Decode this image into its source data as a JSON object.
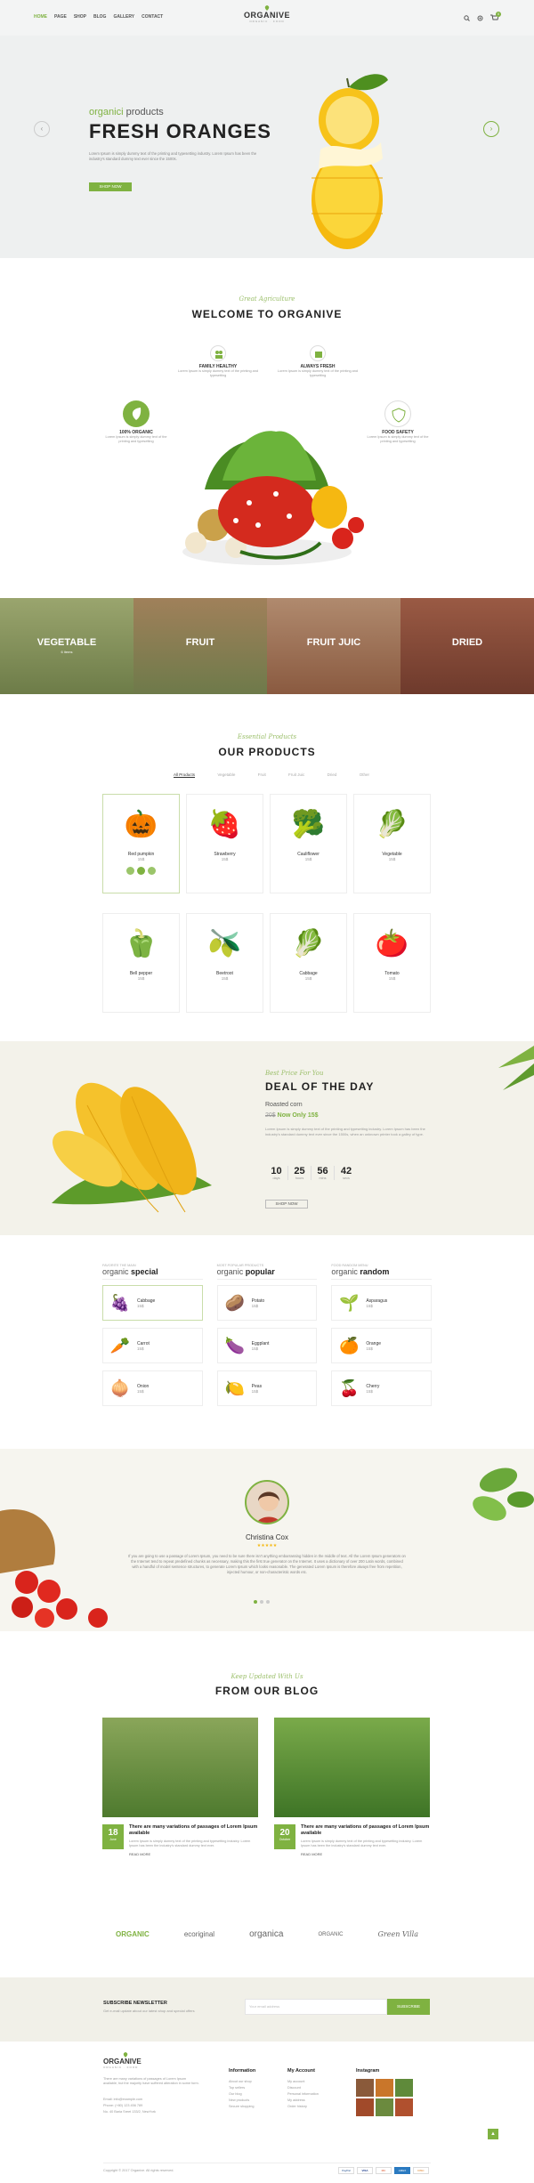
{
  "header": {
    "nav": [
      "HOME",
      "PAGE",
      "SHOP",
      "BLOG",
      "GALLERY",
      "CONTACT"
    ],
    "logo": "ORGANIVE",
    "logo_sub": "ORGANIC · FOOD",
    "cart_count": "0"
  },
  "hero": {
    "kicker_a": "organici",
    "kicker_b": "products",
    "title": "FRESH ORANGES",
    "desc": "Lorem Ipsum is simply dummy text of the printing and typesetting industry. Lorem Ipsum has been the industry's standard dummy text ever since the 1500s.",
    "button": "SHOP NOW"
  },
  "welcome": {
    "script": "Great Agriculture",
    "title": "WELCOME TO ORGANIVE",
    "features": [
      {
        "title": "FAMILY HEALTHY",
        "desc": "Lorem Ipsum is simply dummy text of the printing and typesetting",
        "icon": "family-icon"
      },
      {
        "title": "ALWAYS FRESH",
        "desc": "Lorem Ipsum is simply dummy text of the printing and typesetting",
        "icon": "basket-icon"
      },
      {
        "title": "100% ORGANIC",
        "desc": "Lorem Ipsum is simply dummy text of the printing and typesetting",
        "icon": "leaf-icon"
      },
      {
        "title": "FOOD SAFETY",
        "desc": "Lorem Ipsum is simply dummy text of the printing and typesetting",
        "icon": "shield-icon"
      }
    ]
  },
  "categories": [
    {
      "label": "VEGETABLE",
      "sub": "6 items",
      "color": "#7a8a55"
    },
    {
      "label": "FRUIT",
      "sub": "",
      "color": "#8e6a4a"
    },
    {
      "label": "FRUIT JUIC",
      "sub": "",
      "color": "#8a6a5a"
    },
    {
      "label": "DRIED",
      "sub": "",
      "color": "#7a4a3a"
    }
  ],
  "products": {
    "script": "Essential Products",
    "title": "OUR PRODUCTS",
    "tabs": [
      "All Products",
      "Vegetable",
      "Fruit",
      "Fruit Juic",
      "Dried",
      "Other"
    ],
    "items": [
      {
        "name": "Red pumpkin",
        "price": "15$",
        "emoji": "🎃"
      },
      {
        "name": "Strawberry",
        "price": "15$",
        "emoji": "🍓"
      },
      {
        "name": "Cauliflower",
        "price": "15$",
        "emoji": "🥦"
      },
      {
        "name": "Vegetable",
        "price": "15$",
        "emoji": "🥬"
      },
      {
        "name": "Bell pepper",
        "price": "15$",
        "emoji": "🫑"
      },
      {
        "name": "Beetroot",
        "price": "15$",
        "emoji": "🫒"
      },
      {
        "name": "Cabbage",
        "price": "15$",
        "emoji": "🥬"
      },
      {
        "name": "Tomato",
        "price": "15$",
        "emoji": "🍅"
      }
    ]
  },
  "deal": {
    "script": "Best Price For You",
    "title": "DEAL OF THE DAY",
    "product": "Roasted corn",
    "old_price": "20$",
    "now": "Now Only 15$",
    "desc": "Lorem Ipsum is simply dummy text of the printing and typesetting industry. Lorem Ipsum has been the industry's standard dummy text ever since the 1500s, when an unknown printer took a galley of type.",
    "countdown": [
      {
        "value": "10",
        "unit": "days"
      },
      {
        "value": "25",
        "unit": "hours"
      },
      {
        "value": "56",
        "unit": "mins"
      },
      {
        "value": "42",
        "unit": "secs"
      }
    ],
    "button": "SHOP NOW"
  },
  "lists": [
    {
      "kicker": "FAVORITE THE MAIN",
      "title_a": "organic",
      "title_b": "special",
      "items": [
        {
          "name": "Cabbage",
          "price": "15$",
          "emoji": "🍇"
        },
        {
          "name": "Carrot",
          "price": "15$",
          "emoji": "🥕"
        },
        {
          "name": "Onion",
          "price": "15$",
          "emoji": "🧅"
        }
      ]
    },
    {
      "kicker": "MOST POPULAR PRODUCTS",
      "title_a": "organic",
      "title_b": "popular",
      "items": [
        {
          "name": "Potato",
          "price": "15$",
          "emoji": "🥔"
        },
        {
          "name": "Eggplant",
          "price": "15$",
          "emoji": "🍆"
        },
        {
          "name": "Peas",
          "price": "15$",
          "emoji": "🍋"
        }
      ]
    },
    {
      "kicker": "FOOD RANDOM MENU",
      "title_a": "organic",
      "title_b": "random",
      "items": [
        {
          "name": "Asparagus",
          "price": "15$",
          "emoji": "🌱"
        },
        {
          "name": "Orange",
          "price": "15$",
          "emoji": "🍊"
        },
        {
          "name": "Cherry",
          "price": "15$",
          "emoji": "🍒"
        }
      ]
    }
  ],
  "testimonial": {
    "name": "Christina Cox",
    "stars": "★★★★★",
    "quote": "If you are going to use a passage of Lorem Ipsum, you need to be sure there isn't anything embarrassing hidden in the middle of text. All the Lorem Ipsum generators on the Internet tend to repeat predefined chunks as necessary, making this the first true generator on the Internet. It uses a dictionary of over 200 Latin words, combined with a handful of model sentence structures, to generate Lorem Ipsum which looks reasonable. The generated Lorem Ipsum is therefore always free from repetition, injected humour, or non-characteristic words etc."
  },
  "blog": {
    "script": "Keep Updated With Us",
    "title": "FROM OUR BLOG",
    "posts": [
      {
        "day": "18",
        "month": "June",
        "title": "There are many variations of passages of Lorem Ipsum available",
        "desc": "Lorem Ipsum is simply dummy text of the printing and typesetting industry. Lorem Ipsum has been the industry's standard dummy text ever.",
        "more": "READ MORE"
      },
      {
        "day": "20",
        "month": "October",
        "title": "There are many variations of passages of Lorem Ipsum available",
        "desc": "Lorem Ipsum is simply dummy text of the printing and typesetting industry. Lorem Ipsum has been the industry's standard dummy text ever.",
        "more": "READ MORE"
      }
    ]
  },
  "brands": [
    "ORGANIC",
    "ecoriginal",
    "organica",
    "ORGANIC",
    "Green Villa"
  ],
  "newsletter": {
    "title": "SUBSCRIBE NEWSLETTER",
    "desc": "Get e-mail update about our latest shop and special offers",
    "placeholder": "Your email address",
    "button": "SUBSCRIBE"
  },
  "footer": {
    "logo": "ORGANIVE",
    "logo_sub": "ORGANIC · FOOD",
    "about": "There are many variations of passages of Lorem Ipsum available, but the majority have suffered alteration in some form.",
    "contacts": [
      "Email: info@example.com",
      "Phone: (+80) 123 456 789",
      "No. 40 Baria Sreet 133/2, NewYork"
    ],
    "info_title": "Information",
    "info_links": [
      "About our shop",
      "Top sellers",
      "Our blog",
      "New products",
      "Secure shopping"
    ],
    "account_title": "My Account",
    "account_links": [
      "My account",
      "Discount",
      "Personal information",
      "My address",
      "Order history"
    ],
    "instagram_title": "Instagram",
    "copyright": "Copyright © 2017 Organive. All rights reserved.",
    "payments": [
      "PayPal",
      "VISA",
      "MC",
      "AMEX",
      "DISC"
    ]
  },
  "colors": {
    "accent": "#7fb241",
    "dark": "#222222",
    "hero_bg": "#eef0f0",
    "section_bg": "#f3f2ea"
  }
}
